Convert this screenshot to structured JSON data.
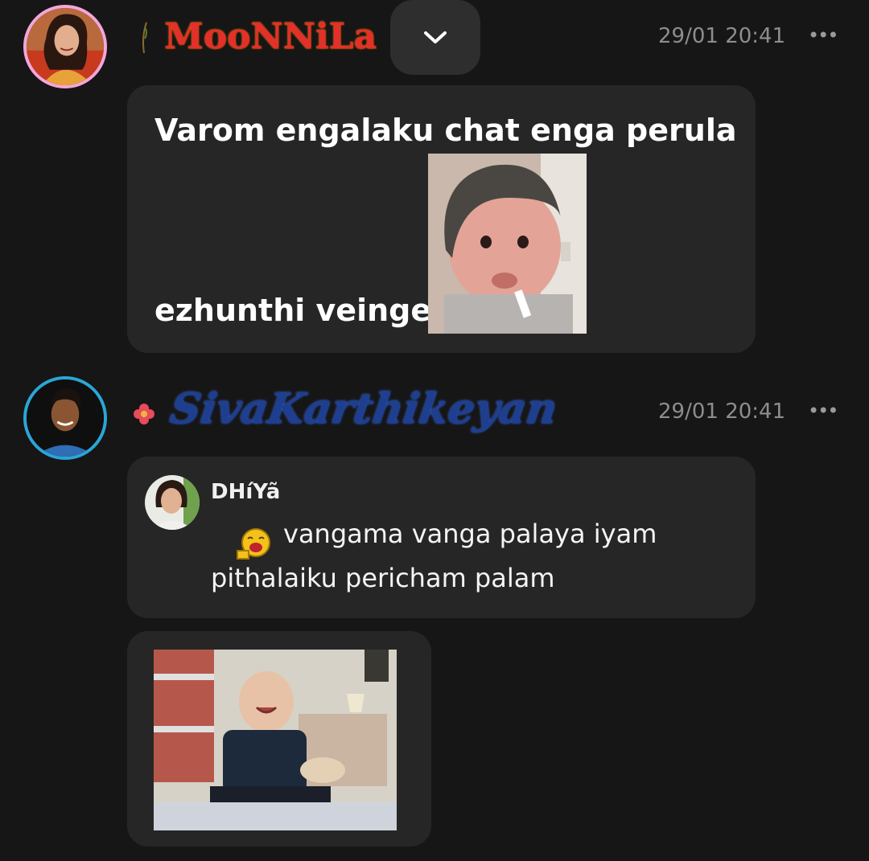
{
  "messages": [
    {
      "sender": "MooNNiLa",
      "timestamp": "29/01 20:41",
      "lines": [
        "Varom engalaku chat enga perula",
        "ezhunthi veinge"
      ],
      "image": "baby-in-beanie-gif"
    },
    {
      "sender": "SivaKarthikeyan",
      "timestamp": "29/01 20:41",
      "reply": {
        "name": "DHíYã",
        "lines": [
          "vangama vanga palaya iyam",
          "pithalaiku pericham palam"
        ]
      },
      "image": "laughing-baby-gif"
    }
  ],
  "controls": {
    "more_label": "•••",
    "dropdown_icon": "chevron-down-icon"
  },
  "colors": {
    "background": "#161616",
    "bubble": "#262626",
    "name1": "#e2302a",
    "name2": "#1e3f8f",
    "avatar1_ring": "#f3a6d9",
    "avatar2_ring": "#2aa6d8"
  }
}
